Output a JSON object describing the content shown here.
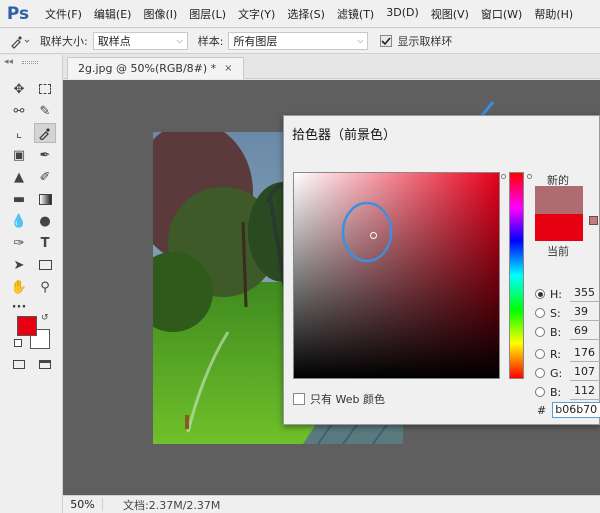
{
  "app": {
    "logo": "Ps"
  },
  "menu": [
    "文件(F)",
    "编辑(E)",
    "图像(I)",
    "图层(L)",
    "文字(Y)",
    "选择(S)",
    "滤镜(T)",
    "3D(D)",
    "视图(V)",
    "窗口(W)",
    "帮助(H)"
  ],
  "options": {
    "sample_size_label": "取样大小:",
    "sample_size_value": "取样点",
    "sample_label": "样本:",
    "sample_value": "所有图层",
    "show_ring_label": "显示取样环",
    "show_ring_checked": true
  },
  "document": {
    "tab_title": "2g.jpg @ 50%(RGB/8#) *",
    "close": "×"
  },
  "status": {
    "zoom": "50%",
    "doc_info": "文档:2.37M/2.37M"
  },
  "color_picker": {
    "title": "拾色器（前景色）",
    "new_label": "新的",
    "current_label": "当前",
    "new_color": "#b06b70",
    "current_color": "#e60012",
    "fields": [
      {
        "label": "H:",
        "value": "355",
        "selected": true
      },
      {
        "label": "S:",
        "value": "39",
        "selected": false
      },
      {
        "label": "B:",
        "value": "69",
        "selected": false
      },
      {
        "label": "R:",
        "value": "176",
        "selected": false
      },
      {
        "label": "G:",
        "value": "107",
        "selected": false
      },
      {
        "label": "B:",
        "value": "112",
        "selected": false
      }
    ],
    "hex_prefix": "#",
    "hex_value": "b06b70",
    "web_only_label": "只有 Web 颜色"
  },
  "foreground_color": "#e60012",
  "background_color": "#ffffff"
}
